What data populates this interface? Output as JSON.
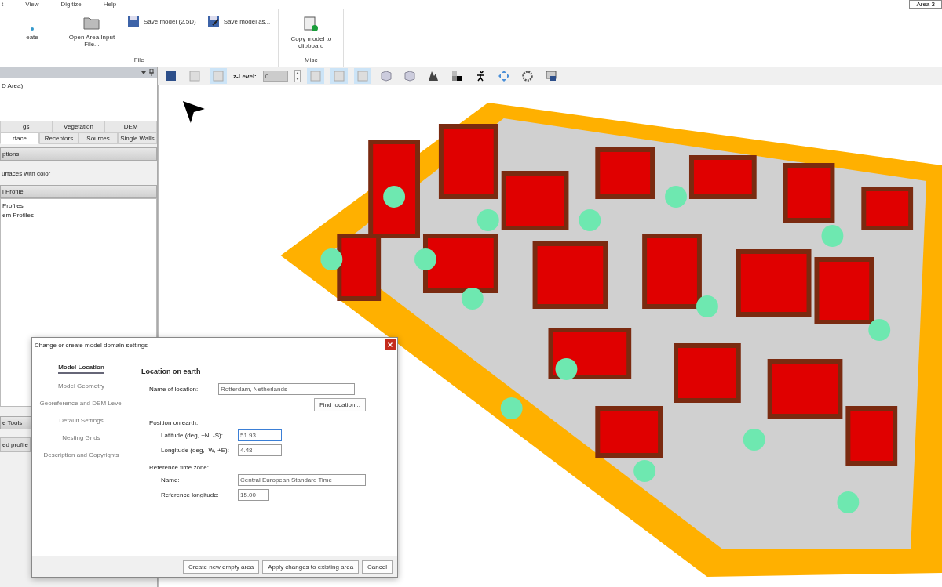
{
  "menu": [
    "t",
    "View",
    "Digitize",
    "Help"
  ],
  "area_button": "Area 3",
  "ribbon": {
    "groups": [
      {
        "label": "File",
        "items": [
          {
            "label": "eate",
            "kind": "large"
          },
          {
            "label": "Open Area Input File...",
            "kind": "large"
          },
          {
            "label": "Save model (2.5D)",
            "kind": "small"
          },
          {
            "label": "Save model as...",
            "kind": "small"
          }
        ]
      },
      {
        "label": "Misc",
        "items": [
          {
            "label": "Copy model to clipboard",
            "kind": "large"
          }
        ]
      }
    ]
  },
  "left_panel": {
    "area_title": "D Area)",
    "tabs_row1": [
      {
        "label": "gs",
        "selected": false
      },
      {
        "label": "Vegetation",
        "selected": false
      },
      {
        "label": "DEM",
        "selected": false
      }
    ],
    "tabs_row2": [
      {
        "label": "rface",
        "selected": true
      },
      {
        "label": "Receptors",
        "selected": false
      },
      {
        "label": "Sources",
        "selected": false
      },
      {
        "label": "Single Walls",
        "selected": false
      }
    ],
    "options_header": "ptions",
    "option_text": "urfaces with color",
    "profile_header": "l Profile",
    "profiles": [
      "Profiles",
      "em Profiles"
    ],
    "tools_header": "e Tools",
    "tools_tab": "ed profile"
  },
  "toolbar": {
    "z_label": "z-Level:",
    "z_value": "0",
    "buttons": [
      {
        "selected": false
      },
      {
        "selected": false
      },
      {
        "selected": true
      },
      {
        "selected": true
      },
      {
        "selected": true
      },
      {
        "selected": true
      },
      {
        "selected": false
      },
      {
        "selected": false
      },
      {
        "selected": false
      },
      {
        "selected": false
      },
      {
        "selected": false
      },
      {
        "selected": false
      },
      {
        "selected": false
      },
      {
        "selected": false
      }
    ]
  },
  "dialog": {
    "title": "Change or create model domain settings",
    "nav": [
      {
        "label": "Model Location",
        "selected": true
      },
      {
        "label": "Model Geometry",
        "selected": false
      },
      {
        "label": "Georeference and DEM Level",
        "selected": false
      },
      {
        "label": "Default Settings",
        "selected": false
      },
      {
        "label": "Nesting Grids",
        "selected": false
      },
      {
        "label": "Description and Copyrights",
        "selected": false
      }
    ],
    "heading": "Location on earth",
    "name_label": "Name of location:",
    "name_value": "Rotterdam, Netherlands",
    "find_button": "Find location...",
    "position_label": "Position on earth:",
    "latitude_label": "Latitude (deg, +N, -S):",
    "latitude_value": "51.93",
    "longitude_label": "Longitude (deg, -W, +E):",
    "longitude_value": "4.48",
    "tz_label": "Reference time zone:",
    "tz_name_label": "Name:",
    "tz_name_value": "Central European Standard Time",
    "ref_lon_label": "Reference longitude:",
    "ref_lon_value": "15.00",
    "buttons": [
      "Create new empty area",
      "Apply changes to existing area",
      "Cancel"
    ]
  }
}
